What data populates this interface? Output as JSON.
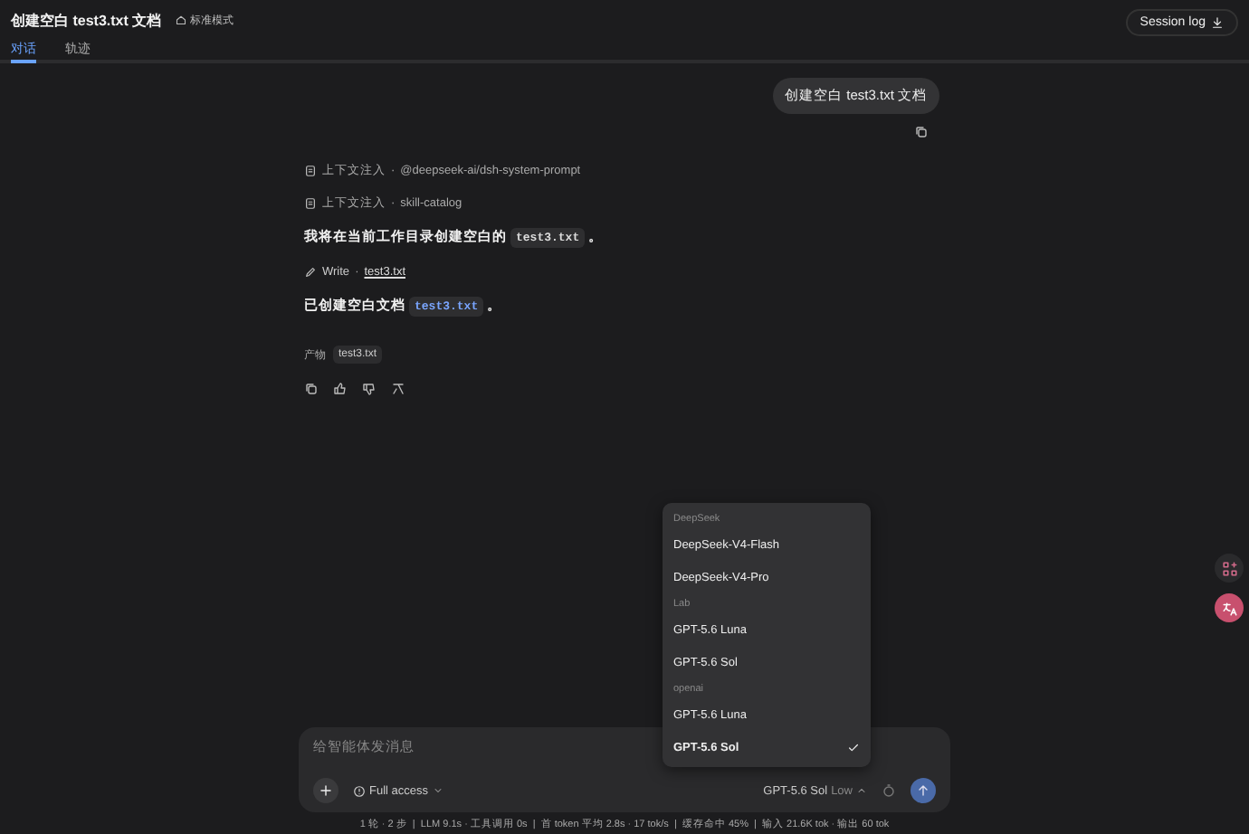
{
  "header": {
    "title": "创建空白 test3.txt 文档",
    "mode_badge": "标准模式",
    "session_log_button": "Session log"
  },
  "tabs": [
    {
      "label": "对话",
      "selected": true
    },
    {
      "label": "轨迹",
      "selected": false
    }
  ],
  "user_message": "创建空白 test3.txt 文档",
  "assistant_steps": [
    {
      "kind": "context",
      "label": "上下文注入",
      "separator": "·",
      "detail": "@deepseek-ai/dsh-system-prompt"
    },
    {
      "kind": "context",
      "label": "上下文注入",
      "separator": "·",
      "detail": "skill-catalog"
    },
    {
      "kind": "text",
      "before": "我将在当前工作目录创建空白的",
      "code": "test3.txt",
      "after": "。",
      "code_link": false
    },
    {
      "kind": "tool",
      "name": "Write",
      "separator": "·",
      "target": "test3.txt"
    },
    {
      "kind": "text",
      "before": "已创建空白文档",
      "code": "test3.txt",
      "after": "。",
      "code_link": true
    }
  ],
  "artifacts": {
    "label": "产物",
    "items": [
      "test3.txt"
    ]
  },
  "model_menu": {
    "groups": [
      {
        "name": "DeepSeek",
        "items": [
          {
            "label": "DeepSeek-V4-Flash",
            "selected": false
          },
          {
            "label": "DeepSeek-V4-Pro",
            "selected": false
          }
        ]
      },
      {
        "name": "Lab",
        "items": [
          {
            "label": "GPT-5.6 Luna",
            "selected": false
          },
          {
            "label": "GPT-5.6 Sol",
            "selected": false
          }
        ]
      },
      {
        "name": "openai",
        "items": [
          {
            "label": "GPT-5.6 Luna",
            "selected": false
          },
          {
            "label": "GPT-5.6 Sol",
            "selected": true
          }
        ]
      }
    ]
  },
  "composer": {
    "placeholder": "给智能体发消息",
    "access": "Full access",
    "model": "GPT-5.6 Sol",
    "effort": "Low"
  },
  "status_bar": "1 轮 · 2 步  |  LLM 9.1s · 工具调用 0s  |  首 token 平均 2.8s · 17 tok/s  |  缓存命中 45%  |  输入 21.6K tok · 输出 60 tok"
}
